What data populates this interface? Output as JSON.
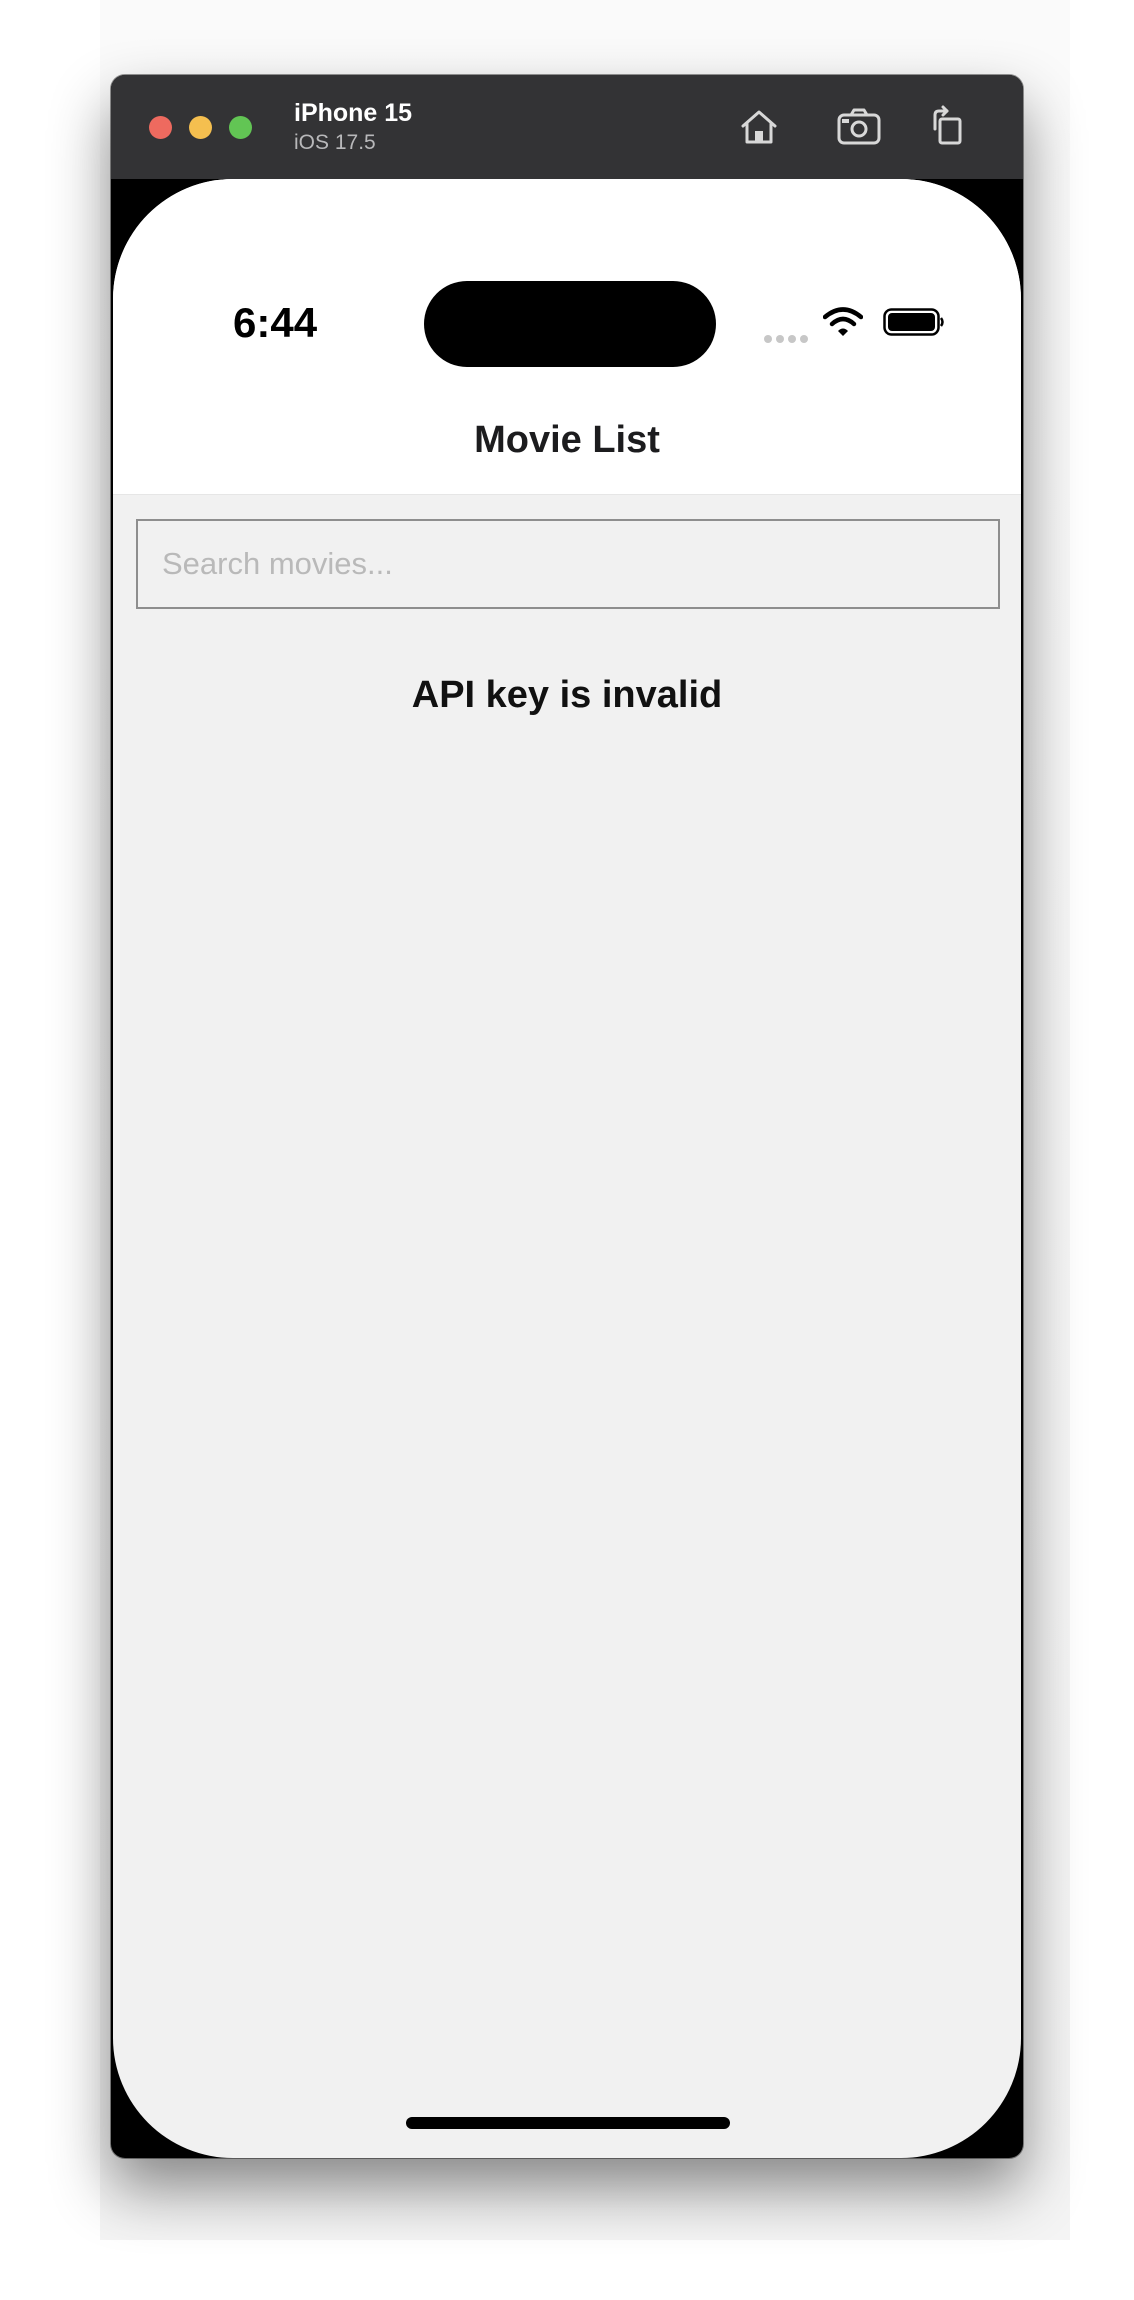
{
  "simulator": {
    "device_name": "iPhone 15",
    "os_version": "iOS 17.5",
    "toolbar": {
      "home_icon": "home-icon",
      "screenshot_icon": "camera-icon",
      "rotate_icon": "rotate-icon"
    },
    "traffic_lights": {
      "close": "#ee6a5f",
      "minimize": "#f5bf4f",
      "zoom": "#62c554"
    }
  },
  "status_bar": {
    "time": "6:44",
    "icons": [
      "signal-icon",
      "wifi-icon",
      "battery-icon"
    ]
  },
  "app": {
    "nav_title": "Movie List",
    "search": {
      "placeholder": "Search movies...",
      "value": ""
    },
    "error_message": "API key is invalid"
  }
}
